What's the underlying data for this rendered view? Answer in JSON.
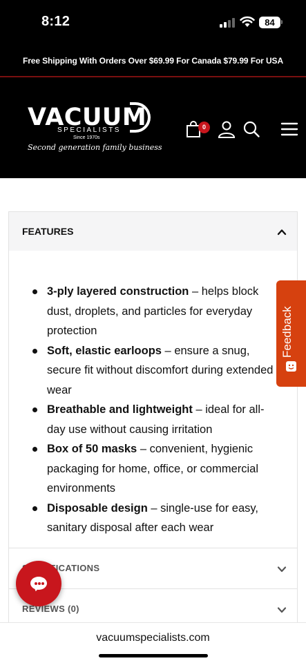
{
  "status_bar": {
    "time": "8:12",
    "battery": "84"
  },
  "promo": {
    "text": "Free Shipping With Orders Over $69.99 For Canada $79.99 For USA"
  },
  "logo": {
    "name": "VACUUM",
    "subtitle": "SPECIALISTS",
    "since": "Since 1970s",
    "tagline": "Second generation family business"
  },
  "header": {
    "cart_count": "0",
    "icons": [
      "cart-icon",
      "account-icon",
      "search-icon",
      "menu-icon"
    ]
  },
  "features": {
    "title": "FEATURES",
    "items": [
      {
        "bold": "3-ply layered construction",
        "text": " – helps block dust, droplets, and particles for everyday protection"
      },
      {
        "bold": "Soft, elastic earloops",
        "text": " – ensure a snug, secure fit without discomfort during extended wear"
      },
      {
        "bold": "Breathable and lightweight",
        "text": " – ideal for all-day use without causing irritation"
      },
      {
        "bold": "Box of 50 masks",
        "text": " – convenient, hygienic packaging for home, office, or commercial environments"
      },
      {
        "bold": "Disposable design",
        "text": " – single-use for easy, sanitary disposal after each wear"
      }
    ]
  },
  "specifications": {
    "title": "SPECIFICATIONS"
  },
  "reviews": {
    "title": "REVIEWS (0)"
  },
  "feedback": {
    "label": "Feedback"
  },
  "url_bar": {
    "url": "vacuumspecialists.com"
  },
  "colors": {
    "brand_red": "#c8161d",
    "feedback_orange": "#d6410f",
    "header_bg": "#000000"
  }
}
